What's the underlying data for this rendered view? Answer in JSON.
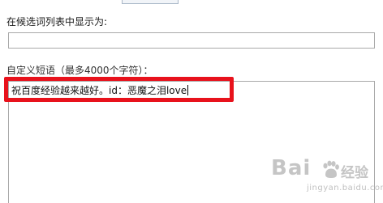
{
  "form": {
    "display_label": "在候选词列表中显示为:",
    "display_input_value": "",
    "custom_phrase_label": "自定义短语（最多4000个字符）：",
    "custom_phrase_value": "祝百度经验越来越好。id：恶魔之泪love"
  },
  "annotation": {
    "highlight_color": "#e8121c"
  },
  "watermark": {
    "brand": "Bai",
    "brand_suffix": "经验",
    "url": "jingyan.baidu.com"
  }
}
